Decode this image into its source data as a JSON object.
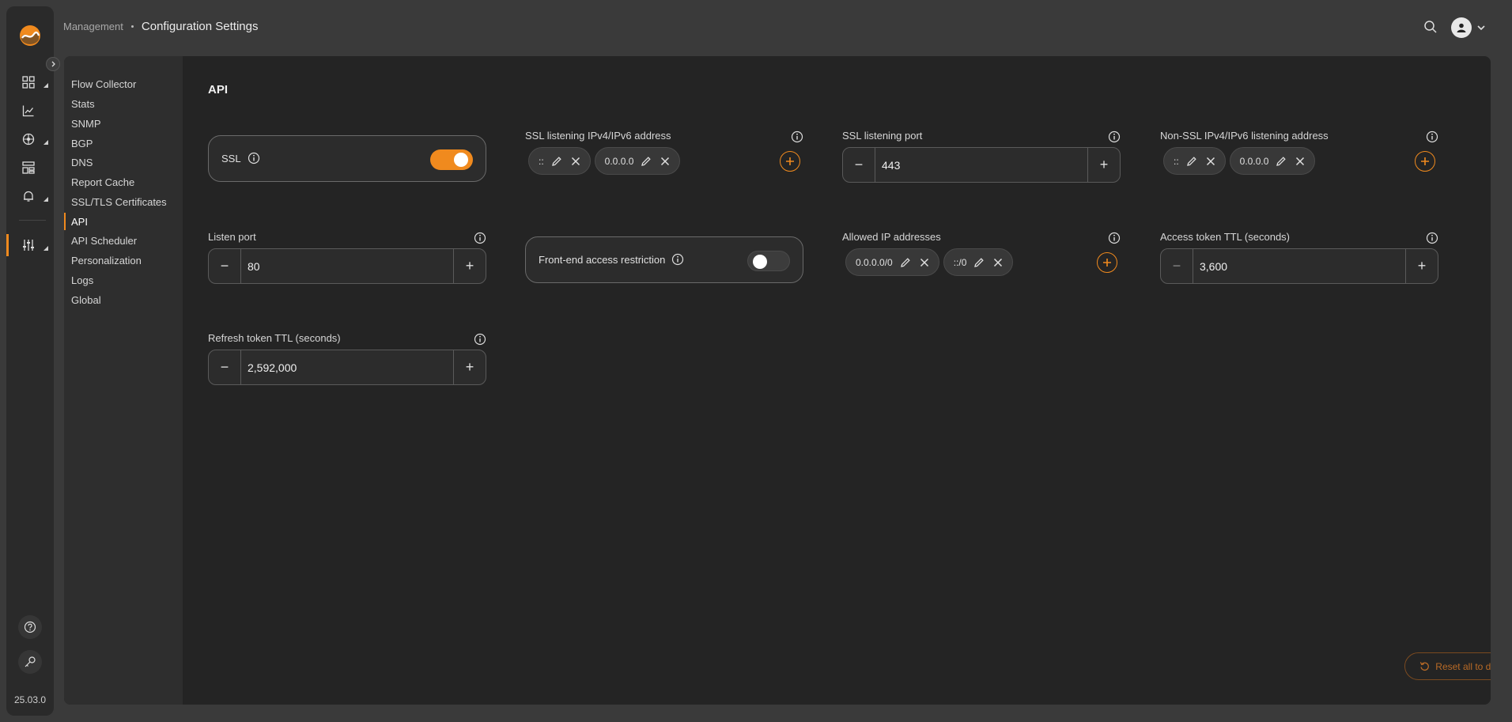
{
  "app": {
    "version": "25.03.0",
    "brand_color": "#f08a1e"
  },
  "breadcrumb": {
    "parent": "Management",
    "current": "Configuration Settings"
  },
  "rail": {
    "icons": [
      "dashboard-icon",
      "chart-icon",
      "network-icon",
      "topology-icon",
      "bell-icon",
      "settings-sliders-icon",
      "help-icon",
      "key-icon"
    ]
  },
  "subnav": {
    "items": [
      "Flow Collector",
      "Stats",
      "SNMP",
      "BGP",
      "DNS",
      "Report Cache",
      "SSL/TLS Certificates",
      "API",
      "API Scheduler",
      "Personalization",
      "Logs",
      "Global"
    ],
    "active": "API"
  },
  "section": {
    "title": "API"
  },
  "fields": {
    "ssl": {
      "label": "SSL",
      "enabled": true
    },
    "ssl_addresses": {
      "label": "SSL listening IPv4/IPv6 address",
      "chips": [
        "::",
        "0.0.0.0"
      ]
    },
    "ssl_port": {
      "label": "SSL listening port",
      "value": "443"
    },
    "non_ssl_addresses": {
      "label": "Non-SSL IPv4/IPv6 listening address",
      "chips": [
        "::",
        "0.0.0.0"
      ]
    },
    "listen_port": {
      "label": "Listen port",
      "value": "80"
    },
    "frontend_restriction": {
      "label": "Front-end access restriction",
      "enabled": false
    },
    "allowed_ips": {
      "label": "Allowed IP addresses",
      "chips": [
        "0.0.0.0/0",
        "::/0"
      ]
    },
    "access_ttl": {
      "label": "Access token TTL (seconds)",
      "value": "3,600"
    },
    "refresh_ttl": {
      "label": "Refresh token TTL (seconds)",
      "value": "2,592,000"
    }
  },
  "actions": {
    "reset_label": "Reset all to default",
    "decrement_glyph": "−",
    "increment_glyph": "+"
  }
}
